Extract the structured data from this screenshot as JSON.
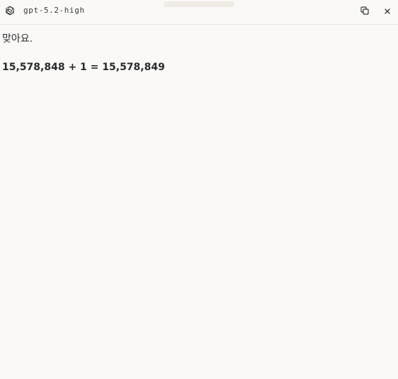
{
  "header": {
    "model_name": "gpt-5.2-high",
    "model_icon": "openai-logo-icon",
    "copy_icon": "copy-icon",
    "close_icon": "close-icon"
  },
  "message": {
    "text": "맞아요.",
    "equation": "15,578,848 + 1 = 15,578,849"
  }
}
